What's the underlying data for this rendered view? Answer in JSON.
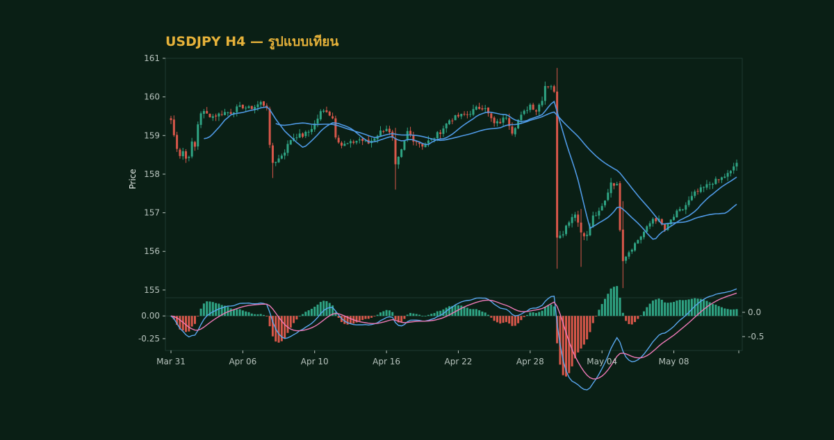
{
  "chart_data": {
    "type": "candlestick",
    "title": "USDJPY H4 — รูปแบบเทียน",
    "ylabel": "Price",
    "price_ylim": [
      154.8,
      161.0
    ],
    "price_yticks": [
      155,
      156,
      157,
      158,
      159,
      160,
      161
    ],
    "macd_ylim": [
      -0.38,
      0.2
    ],
    "macd_left_ticks": [
      0.0,
      -0.25
    ],
    "macd_left_tick_labels": [
      "0.00",
      "-0.25"
    ],
    "macd_right_ticks": [
      0.0,
      -0.5
    ],
    "macd_right_tick_labels": [
      "0.0",
      "-0.5"
    ],
    "x_ticks": [
      {
        "label": "Mar 31",
        "index": 0
      },
      {
        "label": "Apr 06",
        "index": 24
      },
      {
        "label": "Apr 10",
        "index": 48
      },
      {
        "label": "Apr 16",
        "index": 72
      },
      {
        "label": "Apr 22",
        "index": 96
      },
      {
        "label": "Apr 28",
        "index": 120
      },
      {
        "label": "May 04",
        "index": 144
      },
      {
        "label": "May 08",
        "index": 168
      }
    ],
    "price_anchors": [
      [
        0,
        159.4
      ],
      [
        1,
        159.0
      ],
      [
        2,
        158.7
      ],
      [
        3,
        158.5
      ],
      [
        4,
        158.6
      ],
      [
        5,
        158.4
      ],
      [
        6,
        158.5
      ],
      [
        7,
        158.8
      ],
      [
        8,
        158.7
      ],
      [
        9,
        159.3
      ],
      [
        10,
        159.6
      ],
      [
        11,
        159.6
      ],
      [
        12,
        159.55
      ],
      [
        14,
        159.5
      ],
      [
        16,
        159.55
      ],
      [
        18,
        159.6
      ],
      [
        20,
        159.6
      ],
      [
        22,
        159.7
      ],
      [
        24,
        159.75
      ],
      [
        26,
        159.7
      ],
      [
        28,
        159.75
      ],
      [
        30,
        159.85
      ],
      [
        32,
        159.75
      ],
      [
        33,
        158.7
      ],
      [
        34,
        158.3
      ],
      [
        36,
        158.4
      ],
      [
        38,
        158.6
      ],
      [
        40,
        158.9
      ],
      [
        42,
        159.0
      ],
      [
        44,
        159.0
      ],
      [
        46,
        159.1
      ],
      [
        48,
        159.3
      ],
      [
        50,
        159.6
      ],
      [
        52,
        159.65
      ],
      [
        54,
        159.45
      ],
      [
        55,
        159.0
      ],
      [
        57,
        158.75
      ],
      [
        60,
        158.8
      ],
      [
        63,
        158.9
      ],
      [
        66,
        158.8
      ],
      [
        70,
        159.1
      ],
      [
        72,
        159.2
      ],
      [
        74,
        158.9
      ],
      [
        75,
        158.2
      ],
      [
        77,
        158.6
      ],
      [
        79,
        159.1
      ],
      [
        81,
        158.9
      ],
      [
        84,
        158.75
      ],
      [
        87,
        158.9
      ],
      [
        90,
        159.1
      ],
      [
        93,
        159.4
      ],
      [
        96,
        159.5
      ],
      [
        99,
        159.55
      ],
      [
        102,
        159.7
      ],
      [
        105,
        159.75
      ],
      [
        106,
        159.55
      ],
      [
        108,
        159.3
      ],
      [
        110,
        159.35
      ],
      [
        112,
        159.5
      ],
      [
        114,
        159.1
      ],
      [
        116,
        159.4
      ],
      [
        118,
        159.6
      ],
      [
        120,
        159.8
      ],
      [
        122,
        159.65
      ],
      [
        124,
        159.95
      ],
      [
        125,
        160.3
      ],
      [
        127,
        160.3
      ],
      [
        128,
        160.1
      ],
      [
        129,
        156.4
      ],
      [
        131,
        156.5
      ],
      [
        133,
        156.8
      ],
      [
        135,
        157.0
      ],
      [
        137,
        156.5
      ],
      [
        139,
        156.4
      ],
      [
        141,
        156.9
      ],
      [
        143,
        157.0
      ],
      [
        145,
        157.3
      ],
      [
        147,
        157.8
      ],
      [
        149,
        157.7
      ],
      [
        150,
        156.6
      ],
      [
        151,
        155.8
      ],
      [
        153,
        156.0
      ],
      [
        155,
        156.2
      ],
      [
        157,
        156.4
      ],
      [
        159,
        156.6
      ],
      [
        161,
        156.85
      ],
      [
        163,
        156.8
      ],
      [
        165,
        156.55
      ],
      [
        167,
        156.8
      ],
      [
        169,
        157.0
      ],
      [
        171,
        157.1
      ],
      [
        173,
        157.3
      ],
      [
        175,
        157.5
      ],
      [
        177,
        157.6
      ],
      [
        179,
        157.7
      ],
      [
        181,
        157.8
      ],
      [
        183,
        157.85
      ],
      [
        185,
        157.95
      ],
      [
        187,
        158.05
      ],
      [
        188,
        158.2
      ],
      [
        189,
        158.3
      ]
    ],
    "candle_count": 190,
    "series": [
      {
        "kind": "candles",
        "up_color": "#2fa484",
        "down_color": "#d9574a"
      },
      {
        "kind": "ma",
        "period": 12,
        "color": "#4f9ae6"
      },
      {
        "kind": "ma",
        "period": 36,
        "color": "#4f9ae6"
      },
      {
        "kind": "macd_line",
        "color": "#5aa8f0"
      },
      {
        "kind": "macd_signal",
        "color": "#f07ab8"
      },
      {
        "kind": "macd_histogram",
        "up_color": "#2fa484",
        "down_color": "#d9574a"
      }
    ],
    "colors": {
      "background": "#0a1f15",
      "title": "#e6b23a",
      "axis_text": "#b7c3bd",
      "frame": "#1f3a31"
    }
  }
}
